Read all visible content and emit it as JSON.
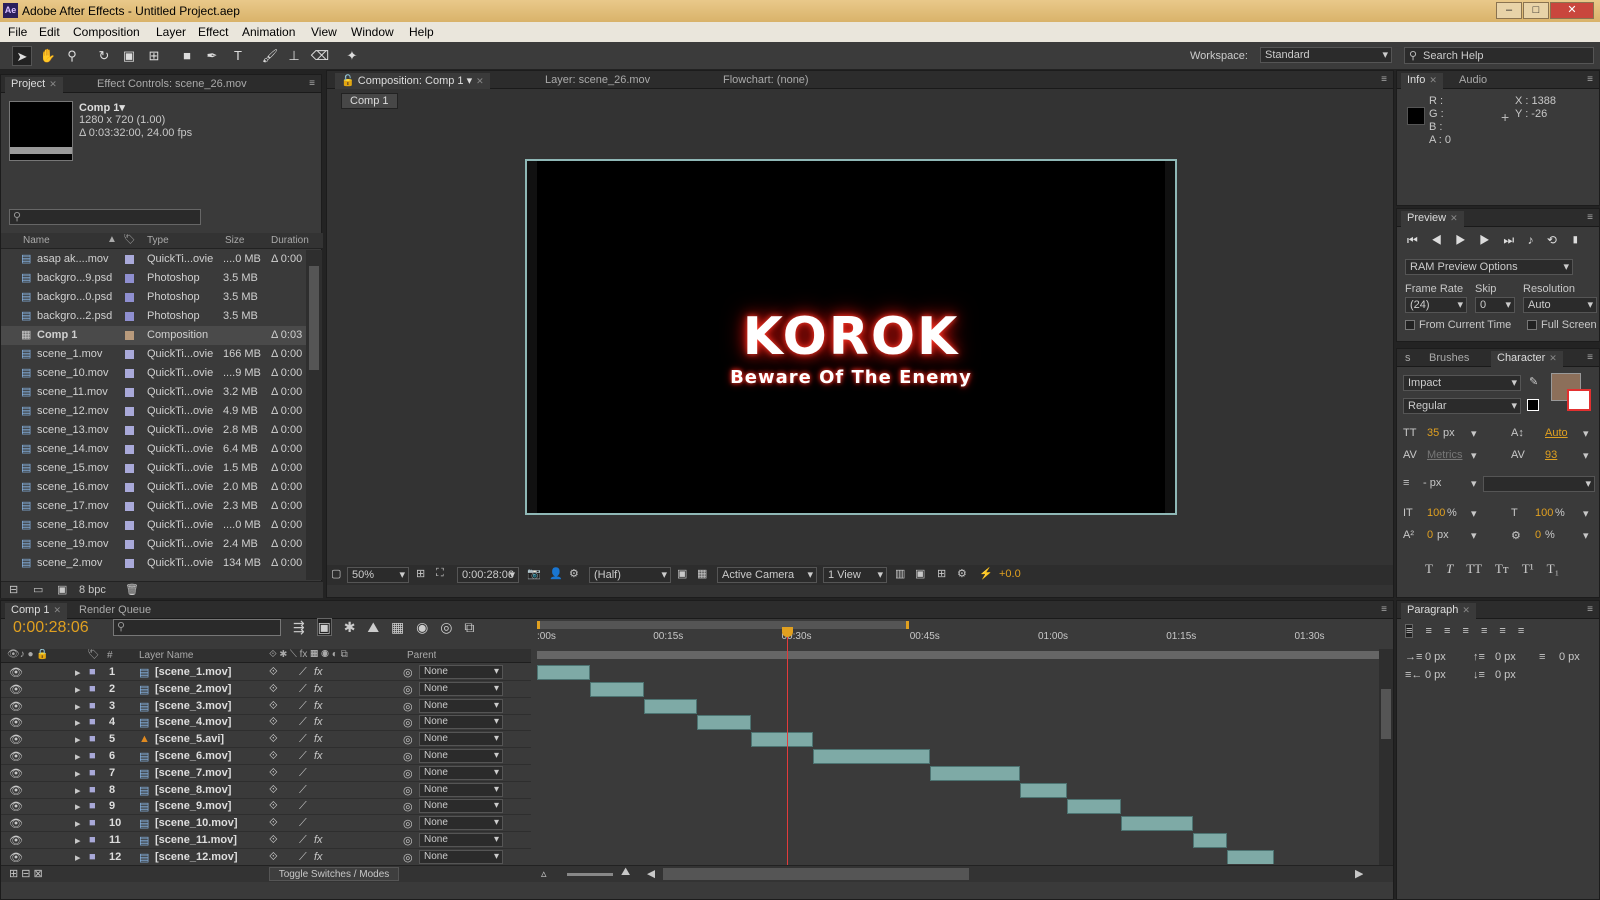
{
  "window": {
    "title": "Adobe After Effects - Untitled Project.aep",
    "logo": "Ae"
  },
  "menu": [
    "File",
    "Edit",
    "Composition",
    "Layer",
    "Effect",
    "Animation",
    "View",
    "Window",
    "Help"
  ],
  "toolbar": {
    "workspace_label": "Workspace:",
    "workspace_value": "Standard",
    "search_placeholder": "Search Help"
  },
  "project": {
    "tabs": [
      "Project",
      "Effect Controls: scene_26.mov"
    ],
    "comp_name": "Comp 1▾",
    "comp_size": "1280 x 720 (1.00)",
    "comp_duration": "Δ 0:03:32:00, 24.00 fps",
    "columns": [
      "Name",
      "Type",
      "Size",
      "Duration"
    ],
    "items": [
      {
        "name": "asap ak....mov",
        "type": "QuickTi...ovie",
        "size": "....0 MB",
        "dur": "Δ 0:00"
      },
      {
        "name": "backgro...9.psd",
        "type": "Photoshop",
        "size": "3.5 MB",
        "dur": ""
      },
      {
        "name": "backgro...0.psd",
        "type": "Photoshop",
        "size": "3.5 MB",
        "dur": ""
      },
      {
        "name": "backgro...2.psd",
        "type": "Photoshop",
        "size": "3.5 MB",
        "dur": ""
      },
      {
        "name": "Comp 1",
        "type": "Composition",
        "size": "",
        "dur": "Δ 0:03"
      },
      {
        "name": "scene_1.mov",
        "type": "QuickTi...ovie",
        "size": "166 MB",
        "dur": "Δ 0:00"
      },
      {
        "name": "scene_10.mov",
        "type": "QuickTi...ovie",
        "size": "....9 MB",
        "dur": "Δ 0:00"
      },
      {
        "name": "scene_11.mov",
        "type": "QuickTi...ovie",
        "size": "3.2 MB",
        "dur": "Δ 0:00"
      },
      {
        "name": "scene_12.mov",
        "type": "QuickTi...ovie",
        "size": "4.9 MB",
        "dur": "Δ 0:00"
      },
      {
        "name": "scene_13.mov",
        "type": "QuickTi...ovie",
        "size": "2.8 MB",
        "dur": "Δ 0:00"
      },
      {
        "name": "scene_14.mov",
        "type": "QuickTi...ovie",
        "size": "6.4 MB",
        "dur": "Δ 0:00"
      },
      {
        "name": "scene_15.mov",
        "type": "QuickTi...ovie",
        "size": "1.5 MB",
        "dur": "Δ 0:00"
      },
      {
        "name": "scene_16.mov",
        "type": "QuickTi...ovie",
        "size": "2.0 MB",
        "dur": "Δ 0:00"
      },
      {
        "name": "scene_17.mov",
        "type": "QuickTi...ovie",
        "size": "2.3 MB",
        "dur": "Δ 0:00"
      },
      {
        "name": "scene_18.mov",
        "type": "QuickTi...ovie",
        "size": "....0 MB",
        "dur": "Δ 0:00"
      },
      {
        "name": "scene_19.mov",
        "type": "QuickTi...ovie",
        "size": "2.4 MB",
        "dur": "Δ 0:00"
      },
      {
        "name": "scene_2.mov",
        "type": "QuickTi...ovie",
        "size": "134 MB",
        "dur": "Δ 0:00"
      }
    ],
    "bpc": "8 bpc"
  },
  "comp_viewer": {
    "tabs": [
      "Composition: Comp 1",
      "Layer: scene_26.mov",
      "Flowchart: (none)"
    ],
    "breadcrumb": "Comp 1",
    "title_text": "KOROK",
    "subtitle_text": "Beware Of The Enemy",
    "zoom": "50%",
    "timecode": "0:00:28:06",
    "resolution": "(Half)",
    "camera": "Active Camera",
    "views": "1 View",
    "exposure": "+0.0"
  },
  "info": {
    "tabs": [
      "Info",
      "Audio"
    ],
    "r": "R :",
    "g": "G :",
    "b": "B :",
    "a": "A : 0",
    "x": "X : 1388",
    "y": "Y : -26"
  },
  "preview": {
    "tab": "Preview",
    "ram_options": "RAM Preview Options",
    "frame_rate_label": "Frame Rate",
    "skip_label": "Skip",
    "resolution_label": "Resolution",
    "frame_rate": "(24)",
    "skip": "0",
    "resolution": "Auto",
    "from_current": "From Current Time",
    "full_screen": "Full Screen"
  },
  "character": {
    "tabs": [
      "s",
      "Brushes",
      "Character"
    ],
    "font": "Impact",
    "style": "Regular",
    "size": "35",
    "px": "px",
    "leading": "Auto",
    "kerning": "Metrics",
    "tracking": "93",
    "stroke_px": "- px",
    "vscale": "100",
    "hscale": "100",
    "pct": "%",
    "baseline": "0",
    "tsume": "0",
    "fill_color": "#8c6f5a"
  },
  "paragraph": {
    "tab": "Paragraph",
    "v1": "0 px",
    "v2": "0 px",
    "v3": "0 px",
    "v4": "0 px",
    "v5": "0 px"
  },
  "timeline": {
    "tabs": [
      "Comp 1",
      "Render Queue"
    ],
    "timecode": "0:00:28:06",
    "ruler": [
      ":00s",
      "00:15s",
      "00:30s",
      "00:45s",
      "01:00s",
      "01:15s",
      "01:30s"
    ],
    "col_layer_name": "Layer Name",
    "col_hash": "#",
    "col_parent": "Parent",
    "toggle_label": "Toggle Switches / Modes",
    "layers": [
      {
        "num": "1",
        "name": "[scene_1.mov]",
        "fx": true,
        "parent": "None",
        "start": 0,
        "end": 6.25
      },
      {
        "num": "2",
        "name": "[scene_2.mov]",
        "fx": true,
        "parent": "None",
        "start": 6.25,
        "end": 12.5
      },
      {
        "num": "3",
        "name": "[scene_3.mov]",
        "fx": true,
        "parent": "None",
        "start": 12.5,
        "end": 18.75
      },
      {
        "num": "4",
        "name": "[scene_4.mov]",
        "fx": true,
        "parent": "None",
        "start": 18.75,
        "end": 25
      },
      {
        "num": "5",
        "name": "[scene_5.avi]",
        "fx": true,
        "parent": "None",
        "start": 25,
        "end": 32.25
      },
      {
        "num": "6",
        "name": "[scene_6.mov]",
        "fx": true,
        "parent": "None",
        "start": 32.25,
        "end": 46
      },
      {
        "num": "7",
        "name": "[scene_7.mov]",
        "fx": false,
        "parent": "None",
        "start": 46,
        "end": 56.5
      },
      {
        "num": "8",
        "name": "[scene_8.mov]",
        "fx": false,
        "parent": "None",
        "start": 56.5,
        "end": 62
      },
      {
        "num": "9",
        "name": "[scene_9.mov]",
        "fx": false,
        "parent": "None",
        "start": 62,
        "end": 68.25
      },
      {
        "num": "10",
        "name": "[scene_10.mov]",
        "fx": false,
        "parent": "None",
        "start": 68.25,
        "end": 76.75
      },
      {
        "num": "11",
        "name": "[scene_11.mov]",
        "fx": true,
        "parent": "None",
        "start": 76.75,
        "end": 80.75
      },
      {
        "num": "12",
        "name": "[scene_12.mov]",
        "fx": true,
        "parent": "None",
        "start": 80.75,
        "end": 86.25
      }
    ]
  }
}
